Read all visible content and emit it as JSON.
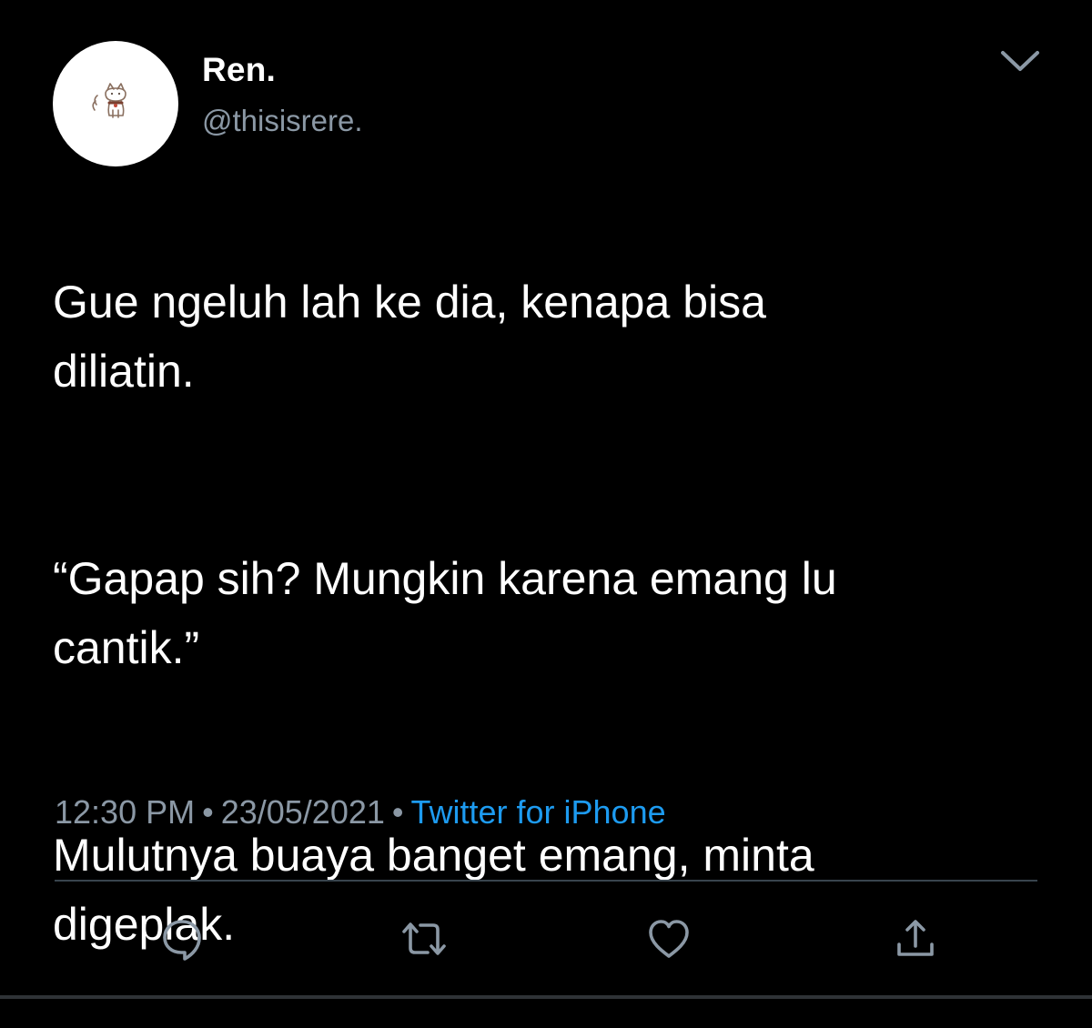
{
  "tweet": {
    "author": {
      "display_name": "Ren.",
      "handle": "@thisisrere.",
      "avatar_icon": "cat-avatar-icon"
    },
    "paragraphs": [
      "Gue ngeluh lah ke dia, kenapa bisa\ndiliatin.",
      "“Gapap sih? Mungkin karena emang lu\ncantik.”",
      "Mulutnya buaya banget emang, minta\ndigeplak."
    ],
    "time": "12:30 PM",
    "separator": "•",
    "date": "23/05/2021",
    "source": "Twitter for iPhone"
  },
  "icons": {
    "more": "chevron-down-icon",
    "reply": "reply-icon",
    "retweet": "retweet-icon",
    "like": "heart-icon",
    "share": "share-icon"
  },
  "colors": {
    "background": "#000000",
    "text": "#ffffff",
    "muted": "#8b98a5",
    "accent": "#1d9bf0",
    "divider": "#38444d"
  }
}
